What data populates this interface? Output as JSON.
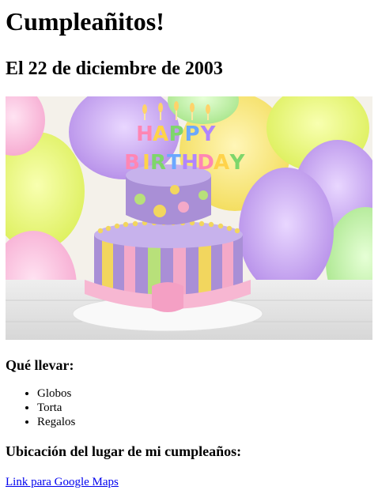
{
  "page": {
    "title": "Cumpleañitos!",
    "date": "El 22 de diciembre de 2003",
    "image_banner_text": "HAPPY BIRTHDAY",
    "bring_heading": "Qué llevar:",
    "bring_items": [
      "Globos",
      "Torta",
      "Regalos"
    ],
    "location_heading": "Ubicación del lugar de mi cumpleaños:",
    "map_link_label": "Link para Google Maps"
  },
  "colors": {
    "link": "#0000ee",
    "cake_purple": "#a98fd6",
    "cake_pink": "#f4a9c8",
    "cake_yellow": "#f2d65e",
    "cake_green": "#b8e07a"
  }
}
